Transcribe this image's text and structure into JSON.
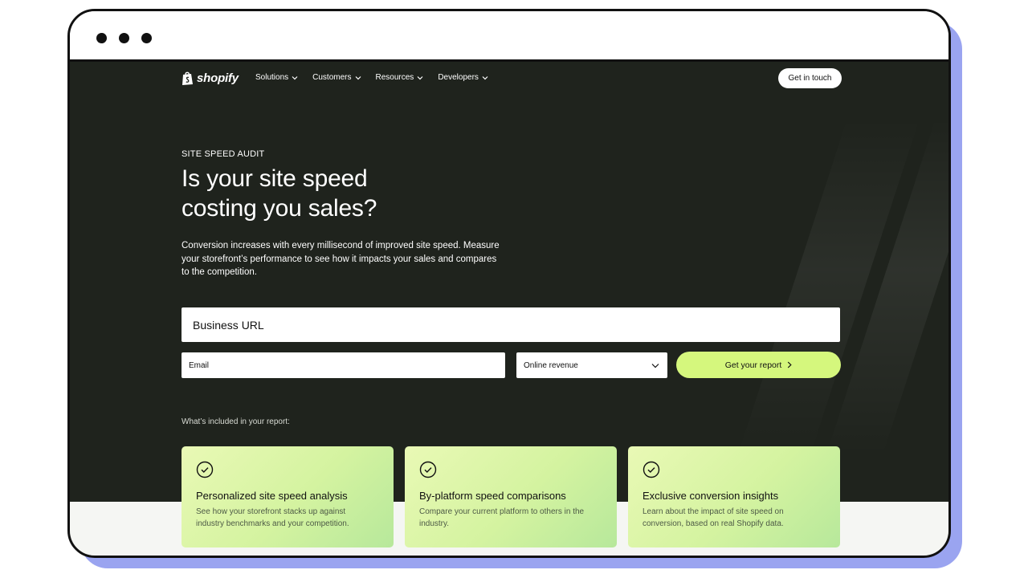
{
  "nav": {
    "logo_text": "shopify",
    "links": [
      {
        "label": "Solutions"
      },
      {
        "label": "Customers"
      },
      {
        "label": "Resources"
      },
      {
        "label": "Developers"
      }
    ],
    "cta_label": "Get in touch"
  },
  "hero": {
    "eyebrow": "SITE SPEED AUDIT",
    "headline_line1": "Is your site speed",
    "headline_line2": "costing you sales?",
    "subcopy": "Conversion increases with every millisecond of improved site speed. Measure your storefront’s performance to see how it impacts your sales and compares to the competition."
  },
  "form": {
    "url_placeholder": "Business URL",
    "email_placeholder": "Email",
    "revenue_selected": "Online revenue",
    "submit_label": "Get your report"
  },
  "included_label": "What’s included in your report:",
  "cards": [
    {
      "title": "Personalized site speed analysis",
      "desc": "See how your storefront stacks up against industry benchmarks and your competition."
    },
    {
      "title": "By-platform speed comparisons",
      "desc": "Compare your current platform to others in the industry."
    },
    {
      "title": "Exclusive conversion insights",
      "desc": "Learn about the impact of site speed on conversion, based on real Shopify data."
    }
  ],
  "colors": {
    "page_bg": "#1f231d",
    "accent": "#d5f77d",
    "frame_shadow": "#9aa4f0"
  },
  "icons": [
    "shopify-bag-icon",
    "chevron-down-icon",
    "chevron-right-icon",
    "check-circle-icon"
  ]
}
